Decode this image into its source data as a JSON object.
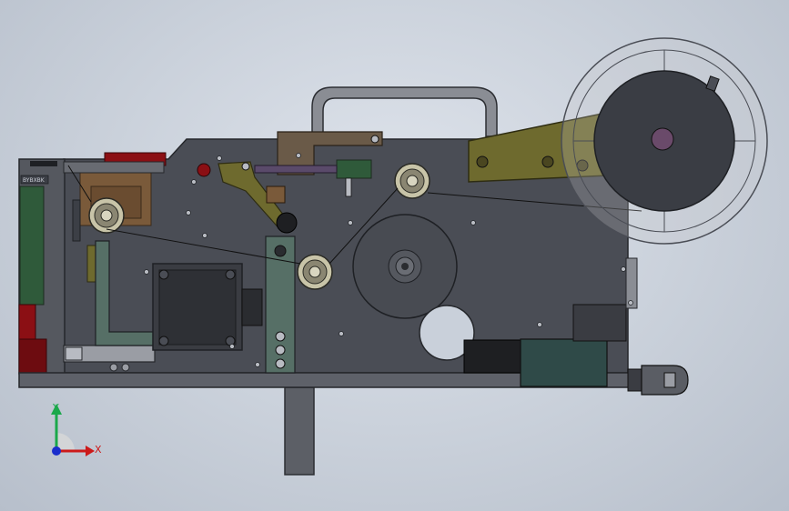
{
  "viewport": {
    "background_top": "#dfe4ec",
    "background_bottom": "#b7bfcb"
  },
  "model": {
    "plate_label": "BYBXBK",
    "frame_color": "#4a4d55",
    "accent_colors": {
      "red": "#8b0f14",
      "green": "#2f5a3a",
      "olive": "#6e6a2e",
      "brown": "#7a5a3a"
    }
  },
  "triad": {
    "x_label": "X",
    "y_label": "Y",
    "x_color": "#cc1a1a",
    "y_color": "#1aa84a",
    "z_color": "#1a2ecc"
  }
}
